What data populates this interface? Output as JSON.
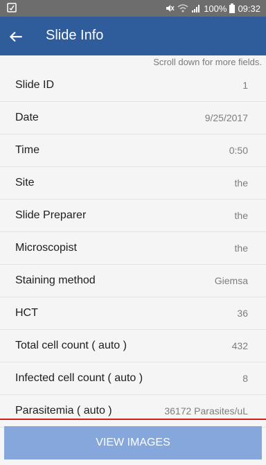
{
  "status_bar": {
    "battery": "100%",
    "time": "09:32"
  },
  "app_bar": {
    "title": "Slide Info"
  },
  "hint": "Scroll down for more fields.",
  "rows": [
    {
      "label": "Slide ID",
      "value": "1"
    },
    {
      "label": "Date",
      "value": "9/25/2017"
    },
    {
      "label": "Time",
      "value": "0:50"
    },
    {
      "label": "Site",
      "value": "the"
    },
    {
      "label": "Slide Preparer",
      "value": "the"
    },
    {
      "label": "Microscopist",
      "value": "the"
    },
    {
      "label": "Staining method",
      "value": "Giemsa"
    },
    {
      "label": "HCT",
      "value": "36"
    },
    {
      "label": "Total cell count ( auto )",
      "value": "432"
    },
    {
      "label": "Infected cell count ( auto )",
      "value": "8"
    },
    {
      "label": "Parasitemia ( auto )",
      "value": "36172 Parasites/uL"
    }
  ],
  "footer": {
    "button_label": "VIEW IMAGES"
  },
  "colors": {
    "app_bar": "#2f5c9a",
    "button": "#86a7dc",
    "divider": "#d81b1b"
  }
}
